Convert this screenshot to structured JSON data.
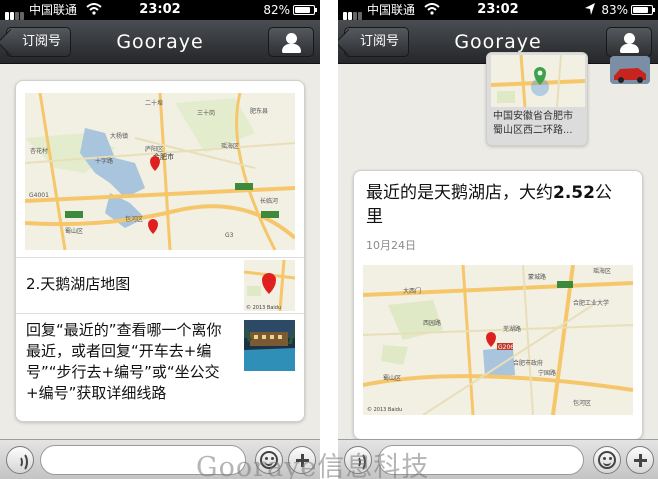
{
  "left": {
    "status": {
      "carrier": "中国联通",
      "time": "23:02",
      "battery": "82%",
      "battery_level": 0.82
    },
    "nav": {
      "back_label": "订阅号",
      "title": "Gooraye"
    },
    "card": {
      "map_labels": [
        "二十埠",
        "十字路",
        "合肥市",
        "庐阳区",
        "瑶海区",
        "包河区",
        "蜀山区",
        "大杨镇",
        "三十岗",
        "杏花村",
        "长临河",
        "肥东县",
        "G4001",
        "G3"
      ],
      "item_title": "2.天鹅湖店地图",
      "thumb_caption": "© 2013 Baidu",
      "body_lines": [
        "回复“最近的”查看哪一个离你",
        "最近，或者回复“开车去+编",
        "号”“步行去+编号”或“坐公交",
        "+编号”获取详细线路"
      ]
    }
  },
  "right": {
    "status": {
      "carrier": "中国联通",
      "time": "23:02",
      "battery": "83%",
      "battery_level": 0.83
    },
    "nav": {
      "back_label": "订阅号",
      "title": "Gooraye"
    },
    "location_bubble": {
      "lines": [
        "中国安徽省合肥市",
        "蜀山区西二环路..."
      ]
    },
    "card": {
      "title_prefix": "最近的是天鹅湖店，大约",
      "title_distance": "2.52",
      "title_line2_part": "公",
      "title_line2": "里",
      "date": "10月24日",
      "map_labels": [
        "合肥工业大学",
        "瑶海区",
        "蜀山区",
        "包河区",
        "西园路",
        "大西门",
        "G206",
        "合肥市政府",
        "芜湖路",
        "蒙城路",
        "宁国路"
      ],
      "map_caption": "© 2013 Baidu"
    }
  },
  "watermark": "Gooraye信息科技",
  "colors": {
    "nav_dark": "#2a2c30",
    "marker": "#e0201e",
    "map_bg": "#f2efe3",
    "water": "#a9c4dd",
    "road": "#f6c76a"
  }
}
